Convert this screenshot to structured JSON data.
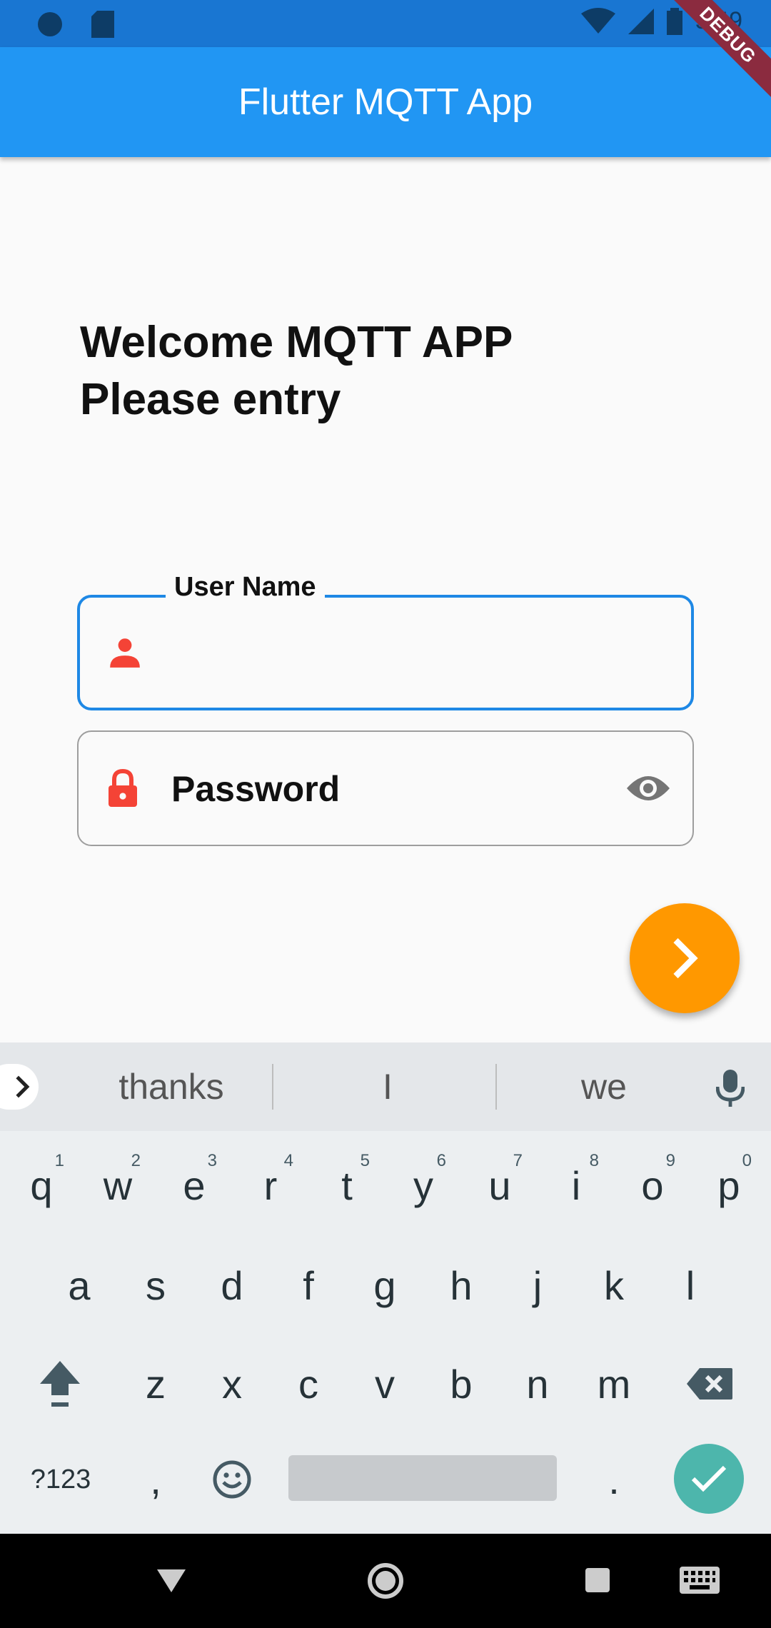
{
  "status_bar": {
    "time": "5:49"
  },
  "debug_banner": "DEBUG",
  "app_bar": {
    "title": "Flutter MQTT App"
  },
  "welcome": {
    "line1": "Welcome MQTT APP",
    "line2": "Please entry"
  },
  "form": {
    "username": {
      "label": "User Name",
      "value": ""
    },
    "password": {
      "placeholder": "Password",
      "value": ""
    }
  },
  "colors": {
    "accent": "#2196f3",
    "fab": "#ff9800",
    "icon_red": "#f44336",
    "enter_key": "#4db6ac"
  },
  "keyboard": {
    "suggestions": [
      "thanks",
      "I",
      "we"
    ],
    "row1": [
      "q",
      "w",
      "e",
      "r",
      "t",
      "y",
      "u",
      "i",
      "o",
      "p"
    ],
    "row1_hints": [
      "1",
      "2",
      "3",
      "4",
      "5",
      "6",
      "7",
      "8",
      "9",
      "0"
    ],
    "row2": [
      "a",
      "s",
      "d",
      "f",
      "g",
      "h",
      "j",
      "k",
      "l"
    ],
    "row3": [
      "z",
      "x",
      "c",
      "v",
      "b",
      "n",
      "m"
    ],
    "symbols_key": "?123",
    "comma_key": ",",
    "period_key": "."
  }
}
